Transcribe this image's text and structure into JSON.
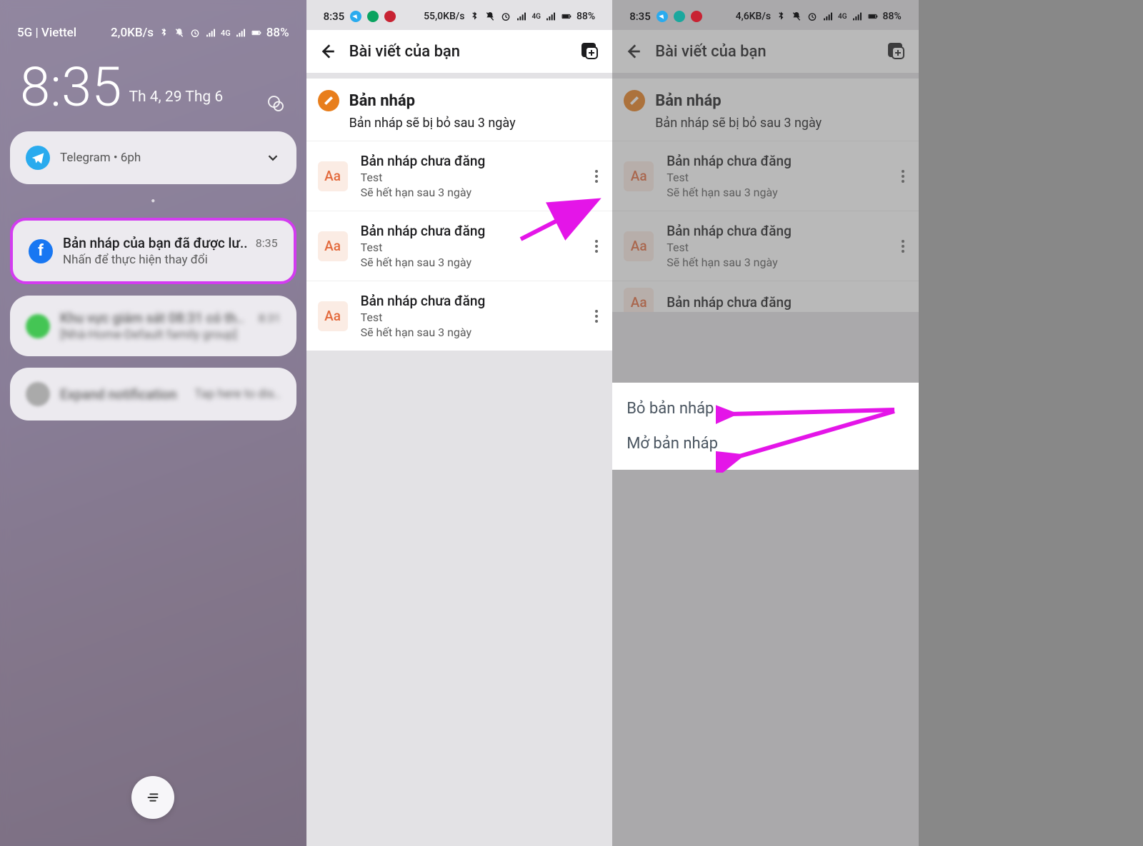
{
  "lockscreen": {
    "carrier": "5G | Viettel",
    "speed": "2,0KB/s",
    "battery": "88%",
    "clock": "8:35",
    "date": "Th 4, 29 Thg 6",
    "telegram_notif": {
      "app": "Telegram",
      "time": "6ph"
    },
    "fb_notif": {
      "title": "Bản nháp của bạn đã được lư..",
      "subtitle": "Nhấn để thực hiện thay đổi",
      "time": "8:35"
    },
    "blurred_notif_1": {
      "title": "Khu vực giám sát 08:31 có th..",
      "subtitle": "[Nhà-Home-Default family group]",
      "time": "8:31"
    },
    "blurred_notif_2": {
      "title": "Expand notification",
      "subtitle": "Tap here to dis.."
    }
  },
  "phone2": {
    "status": {
      "time": "8:35",
      "speed": "55,0KB/s",
      "battery": "88%"
    },
    "header_title": "Bài viết của bạn",
    "section_title": "Bản nháp",
    "section_sub": "Bản nháp sẽ bị bỏ sau 3 ngày",
    "drafts": [
      {
        "title": "Bản nháp chưa đăng",
        "content": "Test",
        "expire": "Sẽ hết hạn sau 3 ngày",
        "thumb": "Aa"
      },
      {
        "title": "Bản nháp chưa đăng",
        "content": "Test",
        "expire": "Sẽ hết hạn sau 3 ngày",
        "thumb": "Aa"
      },
      {
        "title": "Bản nháp chưa đăng",
        "content": "Test",
        "expire": "Sẽ hết hạn sau 3 ngày",
        "thumb": "Aa"
      }
    ]
  },
  "phone3": {
    "status": {
      "time": "8:35",
      "speed": "4,6KB/s",
      "battery": "88%"
    },
    "header_title": "Bài viết của bạn",
    "section_title": "Bản nháp",
    "section_sub": "Bản nháp sẽ bị bỏ sau 3 ngày",
    "drafts": [
      {
        "title": "Bản nháp chưa đăng",
        "content": "Test",
        "expire": "Sẽ hết hạn sau 3 ngày",
        "thumb": "Aa"
      },
      {
        "title": "Bản nháp chưa đăng",
        "content": "Test",
        "expire": "Sẽ hết hạn sau 3 ngày",
        "thumb": "Aa"
      },
      {
        "title": "Bản nháp chưa đăng",
        "content": "",
        "expire": "",
        "thumb": "Aa"
      }
    ],
    "popup": {
      "discard": "Bỏ bản nháp",
      "open": "Mở bản nháp"
    }
  },
  "icons": {
    "network_label": "4G"
  }
}
